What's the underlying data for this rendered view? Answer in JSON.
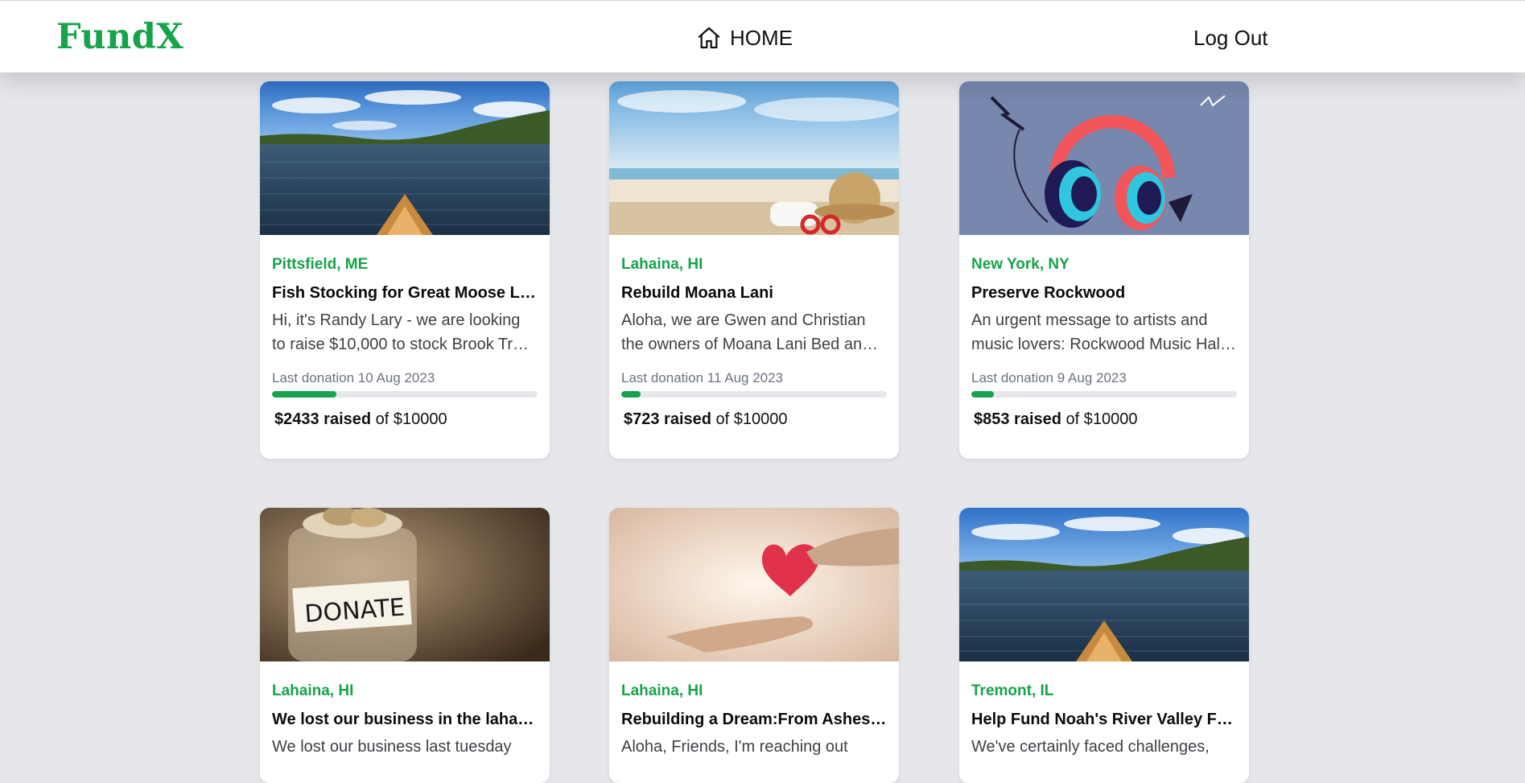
{
  "app": {
    "logo": "FundX",
    "nav": {
      "home_label": "HOME",
      "home_icon": "home-icon",
      "logout_label": "Log Out"
    },
    "accent_color": "#16a34a"
  },
  "campaigns": [
    {
      "location": "Pittsfield, ME",
      "title": "Fish Stocking for Great Moose Lake",
      "description": "Hi, it's Randy Lary - we are looking to raise $10,000 to stock Brook Trout in Great Moose Lake.",
      "last_donation": "Last donation 10 Aug 2023",
      "raised": "$2433 raised",
      "goal": "of $10000",
      "progress": 0.2433,
      "image": "lake-canoe-image"
    },
    {
      "location": "Lahaina, HI",
      "title": "Rebuild Moana Lani",
      "description": "Aloha, we are Gwen and Christian the owners of Moana Lani Bed and Breakfast in Lahaina.",
      "last_donation": "Last donation 11 Aug 2023",
      "raised": "$723 raised",
      "goal": "of $10000",
      "progress": 0.0723,
      "image": "beach-image"
    },
    {
      "location": "New York, NY",
      "title": "Preserve Rockwood",
      "description": "An urgent message to artists and music lovers: Rockwood Music Hall needs your help.",
      "last_donation": "Last donation 9 Aug 2023",
      "raised": "$853 raised",
      "goal": "of $10000",
      "progress": 0.0853,
      "image": "headphones-image"
    },
    {
      "location": "Lahaina, HI",
      "title": "We lost our business in the lahaina fire",
      "description": "We lost our business last tuesday",
      "image": "donate-jar-image"
    },
    {
      "location": "Lahaina, HI",
      "title": "Rebuilding a Dream:From Ashes to Hope",
      "description": "Aloha, Friends, I'm reaching out",
      "image": "heart-hands-image"
    },
    {
      "location": "Tremont, IL",
      "title": "Help Fund Noah's River Valley Fight",
      "description": "We've certainly faced challenges,",
      "image": "lake-canoe-image"
    }
  ]
}
